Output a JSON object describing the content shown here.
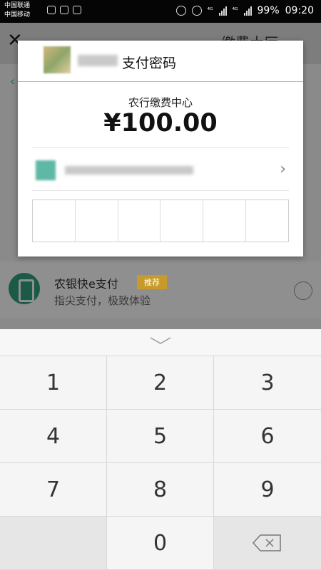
{
  "status_bar": {
    "carrier1": "中国联通",
    "carrier2": "中国移动",
    "net1": "⁴ᴳ",
    "net2": "⁴ᴳ",
    "battery": "99%",
    "time": "09:20"
  },
  "background": {
    "close_icon": "close-icon",
    "title_fragment": "缴费大厅",
    "payment_option": {
      "name": "农银快e支付",
      "badge": "推荐",
      "subtitle": "指尖支付，极致体验"
    }
  },
  "dialog": {
    "title": "支付密码",
    "merchant": "农行缴费中心",
    "amount": "¥100.00",
    "password_cells": 6
  },
  "keypad": {
    "keys": [
      "1",
      "2",
      "3",
      "4",
      "5",
      "6",
      "7",
      "8",
      "9",
      "",
      "0",
      "⌫"
    ]
  },
  "colors": {
    "accent": "#3aa590",
    "badge": "#c79a2a"
  }
}
